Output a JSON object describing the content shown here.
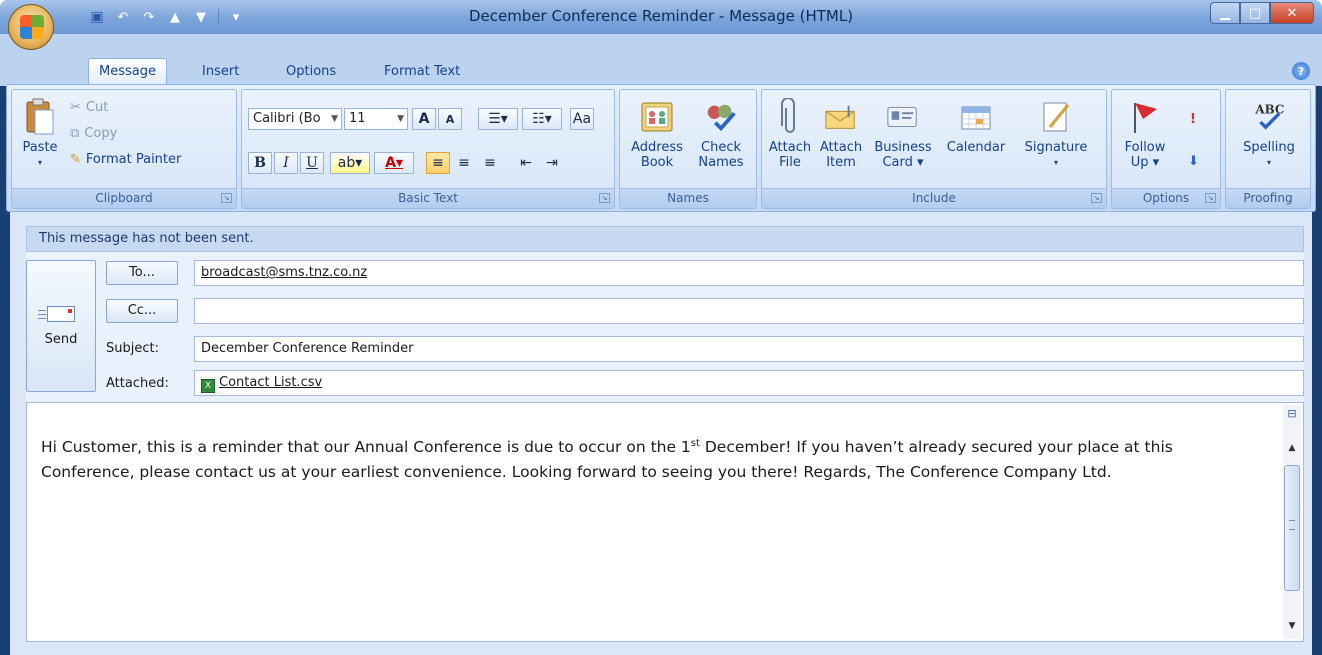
{
  "window": {
    "title": "December Conference Reminder - Message (HTML)",
    "minimize": "▁",
    "maximize": "□",
    "close": "✕"
  },
  "tabs": [
    {
      "label": "Message",
      "active": true
    },
    {
      "label": "Insert"
    },
    {
      "label": "Options"
    },
    {
      "label": "Format Text"
    }
  ],
  "clipboard": {
    "paste": "Paste",
    "cut": "Cut",
    "copy": "Copy",
    "format_painter": "Format Painter",
    "group": "Clipboard"
  },
  "basic_text": {
    "font": "Calibri (Bo",
    "size": "11",
    "group": "Basic Text",
    "bold": "B",
    "italic": "I",
    "underline": "U"
  },
  "names": {
    "address_book": "Address Book",
    "address_book_l1": "Address",
    "address_book_l2": "Book",
    "check_names_l1": "Check",
    "check_names_l2": "Names",
    "group": "Names"
  },
  "include": {
    "attach_file_l1": "Attach",
    "attach_file_l2": "File",
    "attach_item_l1": "Attach",
    "attach_item_l2": "Item",
    "business_card_l1": "Business",
    "business_card_l2": "Card ▾",
    "calendar": "Calendar",
    "signature": "Signature",
    "group": "Include"
  },
  "options": {
    "follow_up_l1": "Follow",
    "follow_up_l2": "Up ▾",
    "group": "Options"
  },
  "proofing": {
    "spelling": "Spelling",
    "group": "Proofing"
  },
  "infobar": "This message has not been sent.",
  "compose": {
    "send": "Send",
    "to_btn": "To...",
    "cc_btn": "Cc...",
    "subject_label": "Subject:",
    "attached_label": "Attached:",
    "to_value": "broadcast@sms.tnz.co.nz",
    "cc_value": "",
    "subject_value": "December Conference Reminder",
    "attachment": "Contact List.csv"
  },
  "body": {
    "part1": "Hi Customer, this is a reminder that our Annual Conference is due to occur on the 1",
    "sup": "st",
    "part2": " December! If you haven’t already secured your place at this Conference, please contact us at your earliest convenience. Looking forward to seeing you there! Regards, The Conference Company Ltd."
  },
  "colors": {
    "accent": "#15428b",
    "frame": "#1a3f73",
    "ribbon": "#d1e2f7"
  }
}
